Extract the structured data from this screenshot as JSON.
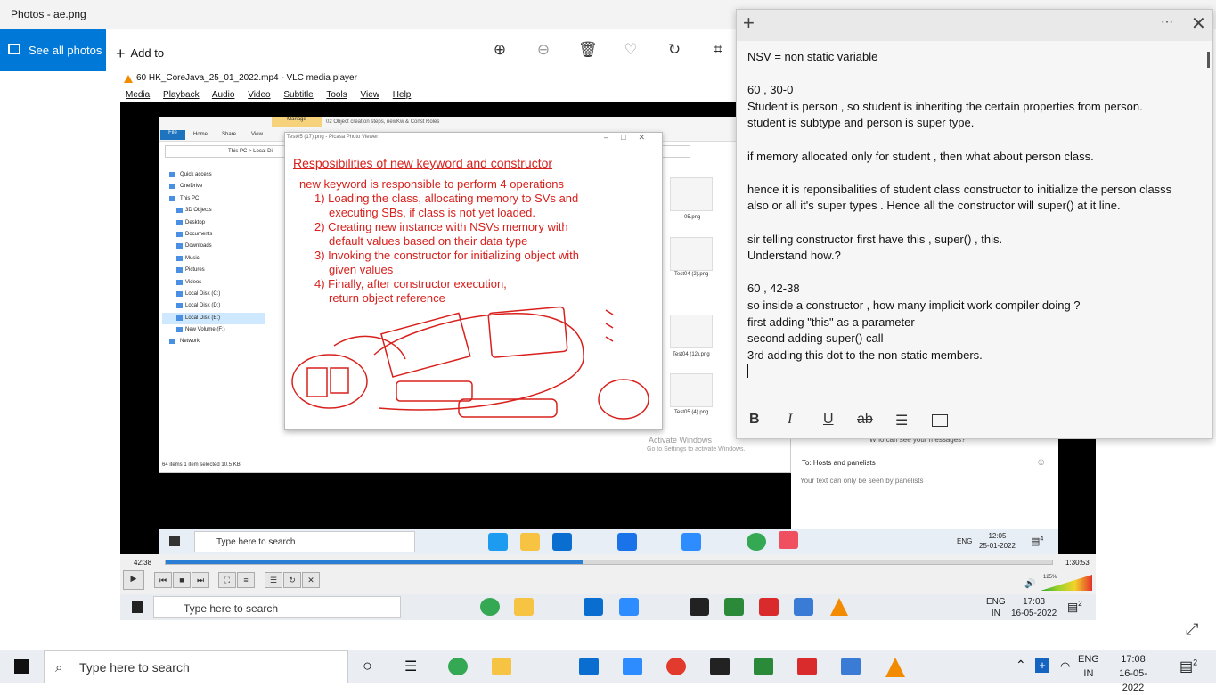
{
  "photos": {
    "title": "Photos - ae.png",
    "see_all": "See all photos",
    "add_to": "Add to",
    "icons": [
      "zoom-in-icon",
      "zoom-out-icon",
      "delete-icon",
      "favorite-icon",
      "rotate-icon",
      "crop-icon"
    ]
  },
  "vlc": {
    "title": "60 HK_CoreJava_25_01_2022.mp4 - VLC media player",
    "menu": [
      "Media",
      "Playback",
      "Audio",
      "Video",
      "Subtitle",
      "Tools",
      "View",
      "Help"
    ],
    "time_elapsed": "42:38",
    "time_total": "1:30:53",
    "progress": 0.47,
    "volume": "125%"
  },
  "explorer": {
    "manage": "Manage",
    "ribbon_title": "02 Object creation steps, newKw & Const Roles",
    "tabs": [
      "File",
      "Home",
      "Share",
      "View"
    ],
    "address": "This PC  >  Local Di",
    "tree": [
      "Quick access",
      "OneDrive",
      "This PC",
      "3D Objects",
      "Desktop",
      "Documents",
      "Downloads",
      "Music",
      "Pictures",
      "Videos",
      "Local Disk (C:)",
      "Local Disk (D:)",
      "Local Disk (E:)",
      "New Volume (F:)",
      "Network"
    ],
    "status": "64 items    1 item selected  10.5 KB",
    "thumbs": [
      "05.png",
      "Test04 (2).png",
      "Test04 (12).png",
      "Test05 (4).png"
    ]
  },
  "picasa": {
    "title": "Test05 (17).png - Picasa Photo Viewer",
    "slide_title": "Resposibilities of new keyword and constructor",
    "lines": [
      "new keyword is responsible to perform 4 operations",
      "1) Loading the class, allocating memory to SVs and",
      "executing SBs, if class is not yet loaded.",
      "2) Creating new instance with NSVs memory with",
      "default values based on their data type",
      "3) Invoking the constructor for initializing object with",
      "given values",
      "4) Finally, after constructor execution,",
      "return object reference"
    ],
    "activate": "Activate Windows",
    "activate_sub": "Go to Settings to activate Windows."
  },
  "chat": {
    "who": "Who can see your messages?",
    "to": "To:  Hosts and panelists",
    "placeholder": "Your text can only be seen by panelists"
  },
  "inner_taskbar": {
    "search": "Type here to search",
    "lang": "ENG",
    "time": "12:05",
    "date": "25-01-2022",
    "badge": "4"
  },
  "middle_taskbar": {
    "search": "Type here to search",
    "lang": "ENG",
    "region": "IN",
    "time": "17:03",
    "date": "16-05-2022",
    "badge": "2"
  },
  "outer_taskbar": {
    "search": "Type here to search",
    "lang": "ENG",
    "region": "IN",
    "time": "17:08",
    "date": "16-05-2022",
    "badge": "2"
  },
  "note": {
    "lines": [
      "NSV = non static variable",
      "",
      "60 , 30-0",
      "Student is person , so student is inheriting the certain properties from person.",
      "student is subtype and person is super type.",
      "",
      "if memory allocated only for student , then what about person class.",
      "",
      "hence it is reponsibalities of student class constructor to initialize the person classs",
      "also or all it's super types . Hence all the constructor will super() at it line.",
      "",
      "sir telling constructor first have this , super() , this.",
      "Understand how.?",
      "",
      "60 , 42-38",
      "so inside a constructor , how many implicit work compiler doing ?",
      "first adding \"this\" as a parameter",
      "second adding super() call",
      "3rd adding this dot to the non static members."
    ],
    "format": {
      "bold": "B",
      "italic": "I",
      "underline": "U",
      "strike": "ab"
    }
  }
}
